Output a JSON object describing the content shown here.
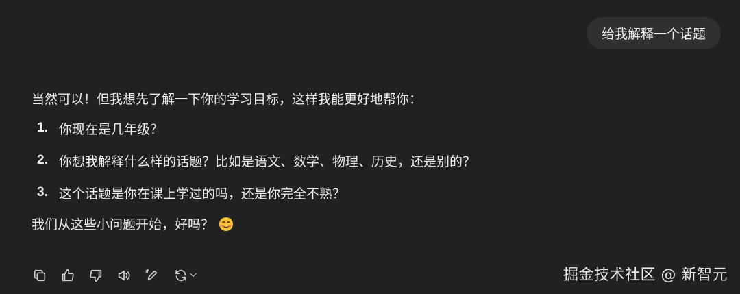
{
  "user_message": "给我解释一个话题",
  "assistant": {
    "intro": "当然可以！但我想先了解一下你的学习目标，这样我能更好地帮你：",
    "questions": [
      {
        "num": "1.",
        "text": "你现在是几年级？"
      },
      {
        "num": "2.",
        "text": "你想我解释什么样的话题？比如是语文、数学、物理、历史，还是别的？"
      },
      {
        "num": "3.",
        "text": "这个话题是你在课上学过的吗，还是你完全不熟？"
      }
    ],
    "outro": "我们从这些小问题开始，好吗？"
  },
  "actions": {
    "icons": [
      "copy-icon",
      "thumbs-up-icon",
      "thumbs-down-icon",
      "speaker-icon",
      "edit-icon",
      "regenerate-icon",
      "chevron-down-icon"
    ]
  },
  "watermark": "掘金技术社区 @ 新智元",
  "colors": {
    "background": "#212121",
    "bubble": "#303030",
    "text": "#ececec",
    "icon": "#d0d0d0"
  }
}
